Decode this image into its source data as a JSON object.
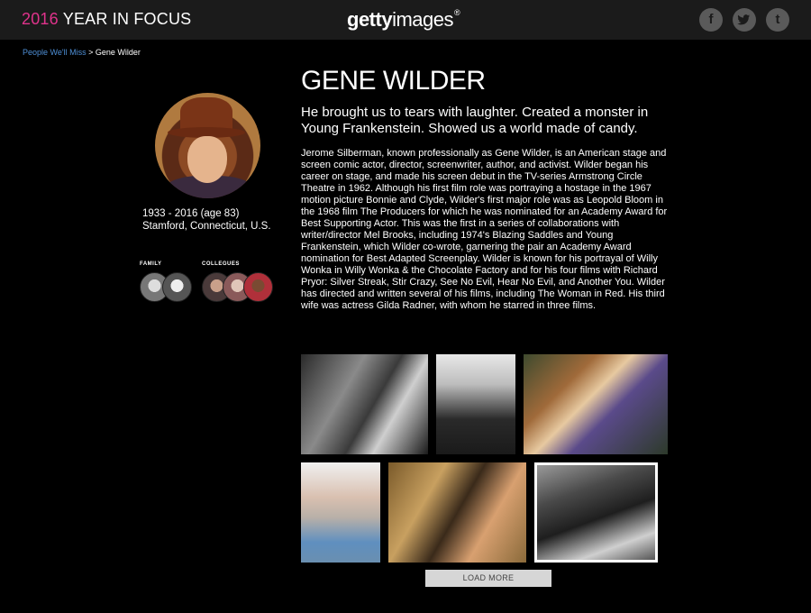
{
  "header": {
    "brand_year": "2016",
    "brand_rest": "YEAR IN FOCUS",
    "logo_bold": "getty",
    "logo_light": "images",
    "logo_reg": "®",
    "social": [
      {
        "icon": "facebook-icon",
        "glyph": "f"
      },
      {
        "icon": "twitter-icon",
        "glyph": "t"
      },
      {
        "icon": "tumblr-icon",
        "glyph": "t"
      }
    ]
  },
  "breadcrumb": {
    "parent": "People We'll Miss",
    "separator": ">",
    "current": "Gene Wilder"
  },
  "profile": {
    "dates": "1933 - 2016 (age 83)",
    "birthplace": "Stamford, Connecticut, U.S.",
    "family_label": "FAMILY",
    "colleagues_label": "COLLEGUES"
  },
  "main": {
    "title": "GENE WILDER",
    "tagline": "He brought us to tears with laughter. Created a monster in Young Frankenstein. Showed us a world made of candy.",
    "bio": "Jerome Silberman, known professionally as Gene Wilder, is an American stage and screen comic actor, director, screenwriter, author, and activist. Wilder began his career on stage, and made his screen debut in the TV-series Armstrong Circle Theatre in 1962. Although his first film role was portraying a hostage in the 1967 motion picture Bonnie and Clyde, Wilder's first major role was as Leopold Bloom in the 1968 film The Producers for which he was nominated for an Academy Award for Best Supporting Actor. This was the first in a series of collaborations with writer/director Mel Brooks, including 1974's Blazing Saddles and Young Frankenstein, which Wilder co-wrote, garnering the pair an Academy Award nomination for Best Adapted Screenplay. Wilder is known for his portrayal of Willy Wonka in Willy Wonka & the Chocolate Factory and for his four films with Richard Pryor: Silver Streak, Stir Crazy, See No Evil, Hear No Evil, and Another You. Wilder has directed and written several of his films, including The Woman in Red. His third wife was actress Gilda Radner, with whom he starred in three films.",
    "load_more": "LOAD MORE"
  },
  "colors": {
    "accent_pink": "#e0338c",
    "link_blue": "#4e8fd6",
    "header_bg": "#1b1b1b"
  }
}
